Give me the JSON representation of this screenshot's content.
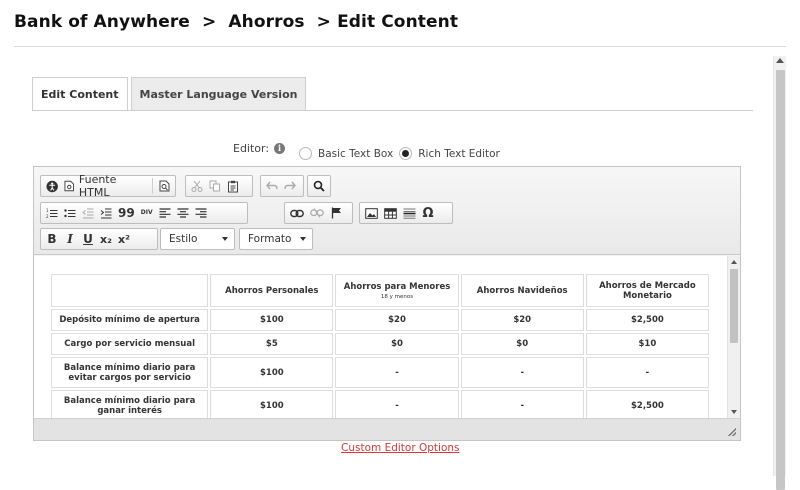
{
  "breadcrumb": {
    "items": [
      "Bank of Anywhere",
      "Ahorros",
      "Edit Content"
    ],
    "separator": ">"
  },
  "tabs": [
    {
      "label": "Edit Content",
      "active": true
    },
    {
      "label": "Master Language Version",
      "active": false
    }
  ],
  "editor_select": {
    "label": "Editor:",
    "options": [
      "Basic Text Box",
      "Rich Text Editor"
    ],
    "selected": "Rich Text Editor"
  },
  "toolbar": {
    "source_label": "Fuente HTML",
    "style_dropdown": "Estilo",
    "format_dropdown": "Formato",
    "blockquote_glyph": "99",
    "div_glyph": "DIV",
    "omega_glyph": "Ω",
    "bold_glyph": "B",
    "italic_glyph": "I",
    "underline_glyph": "U",
    "subscript_glyph": "x₂",
    "superscript_glyph": "x²"
  },
  "table": {
    "headers": [
      {
        "title": "",
        "sub": ""
      },
      {
        "title": "Ahorros Personales",
        "sub": ""
      },
      {
        "title": "Ahorros para Menores",
        "sub": "18 y menos"
      },
      {
        "title": "Ahorros Navideños",
        "sub": ""
      },
      {
        "title": "Ahorros de Mercado Monetario",
        "sub": ""
      }
    ],
    "rows": [
      [
        "Depósito mínimo de apertura",
        "$100",
        "$20",
        "$20",
        "$2,500"
      ],
      [
        "Cargo por servicio mensual",
        "$5",
        "$0",
        "$0",
        "$10"
      ],
      [
        "Balance mínimo diario para evitar cargos por servicio",
        "$100",
        "-",
        "-",
        "-"
      ],
      [
        "Balance mínimo diario para ganar interés",
        "$100",
        "-",
        "-",
        "$2,500"
      ]
    ]
  },
  "footer_link": "Custom Editor Options",
  "colors": {
    "link": "#d8383a",
    "border": "#c4c4c4"
  }
}
